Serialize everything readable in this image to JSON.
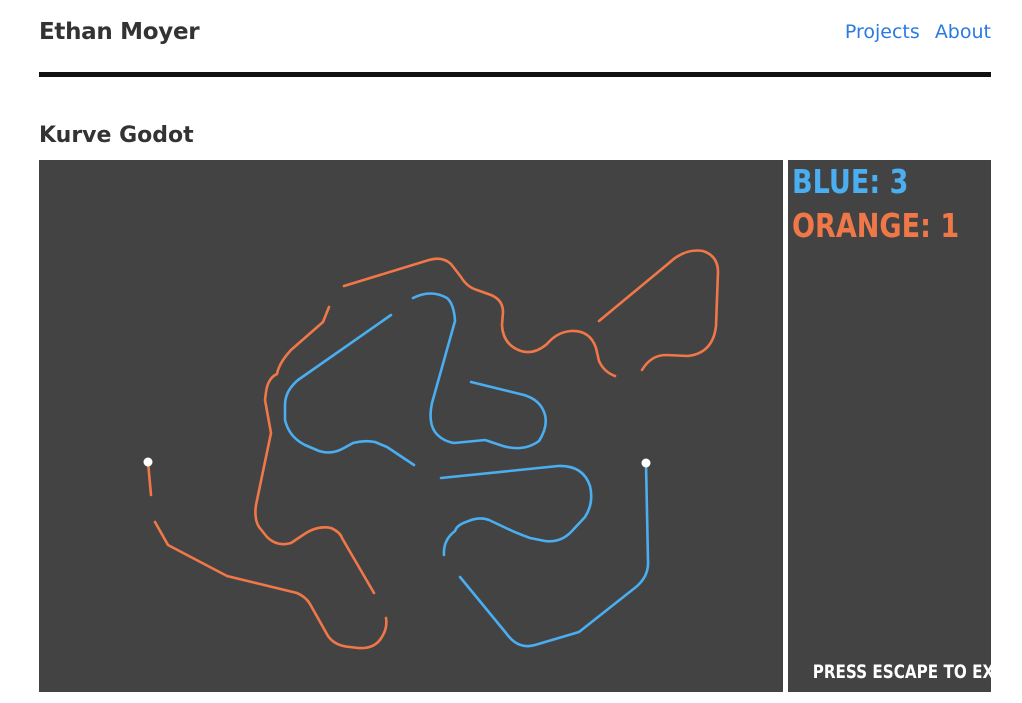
{
  "site": {
    "title": "Ethan Moyer",
    "nav": [
      {
        "label": "Projects"
      },
      {
        "label": "About"
      }
    ]
  },
  "page": {
    "title": "Kurve Godot"
  },
  "game": {
    "colors": {
      "background": "#434343",
      "blue": "#4aaef0",
      "orange": "#f07848",
      "head": "#ffffff"
    },
    "scores": [
      {
        "player": "BLUE",
        "score": 3,
        "text": "BLUE: 3",
        "color": "#4aaef0"
      },
      {
        "player": "ORANGE",
        "score": 1,
        "text": "ORANGE: 1",
        "color": "#f07848"
      }
    ],
    "exit_hint": "PRESS ESCAPE TO EXIT"
  }
}
